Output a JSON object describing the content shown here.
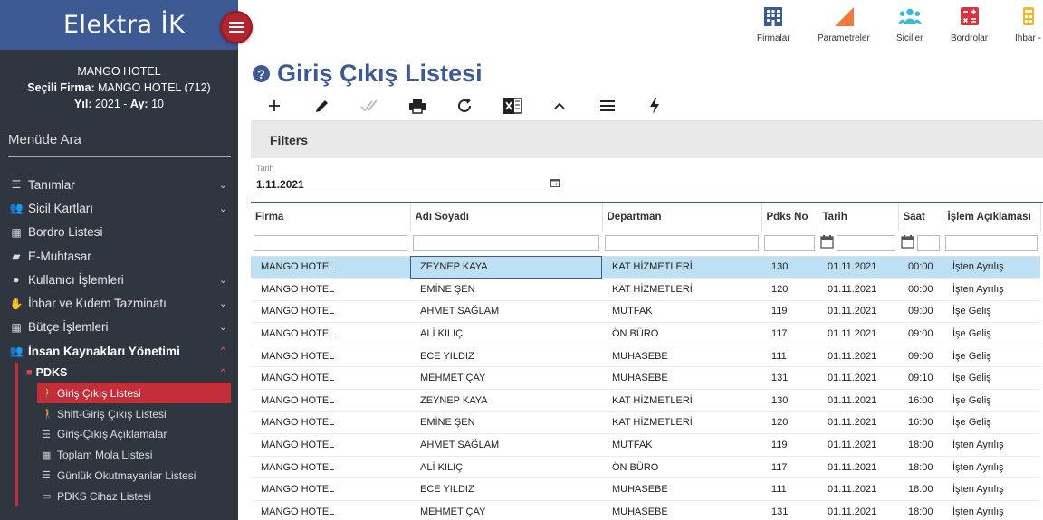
{
  "brand": {
    "title": "Elektra İK"
  },
  "firm_info": {
    "hotel": "MANGO HOTEL",
    "selected_label": "Seçili Firma:",
    "selected_value": "MANGO HOTEL (712)",
    "year_label": "Yıl:",
    "year_value": "2021",
    "month_label": "Ay:",
    "month_value": "10"
  },
  "menu_search": {
    "placeholder": "Menüde Ara"
  },
  "menu": {
    "items": [
      {
        "label": "Tanımlar",
        "icon": "list-icon"
      },
      {
        "label": "Sicil Kartları",
        "icon": "users-icon"
      },
      {
        "label": "Bordro Listesi",
        "icon": "calculator-icon"
      },
      {
        "label": "E-Muhtasar",
        "icon": "folder-icon"
      },
      {
        "label": "Kullanıcı İşlemleri",
        "icon": "user-gear-icon"
      },
      {
        "label": "İhbar ve Kıdem Tazminatı",
        "icon": "hand-money-icon"
      },
      {
        "label": "Bütçe İşlemleri",
        "icon": "calculator-icon"
      },
      {
        "label": "İnsan Kaynakları Yönetimi",
        "icon": "people-icon"
      }
    ],
    "pdks": {
      "label": "PDKS",
      "items": [
        {
          "label": "Giriş Çıkış Listesi",
          "icon": "walking-icon"
        },
        {
          "label": "Shift-Giriş Çıkış Listesi",
          "icon": "walking-icon"
        },
        {
          "label": "Giriş-Çıkış Açıklamalar",
          "icon": "list-icon"
        },
        {
          "label": "Toplam Mola Listesi",
          "icon": "table-icon"
        },
        {
          "label": "Günlük Okutmayanlar Listesi",
          "icon": "list-icon"
        },
        {
          "label": "PDKS Cihaz Listesi",
          "icon": "monitor-icon"
        }
      ]
    }
  },
  "topbar": {
    "buttons": [
      {
        "label": "Firmalar",
        "icon": "building-icon",
        "color": "#3d5a95"
      },
      {
        "label": "Parametreler",
        "icon": "triangle-icon",
        "color": "#f07a3c"
      },
      {
        "label": "Siciller",
        "icon": "users-icon",
        "color": "#3cb8d6"
      },
      {
        "label": "Bordrolar",
        "icon": "calculator-icon",
        "color": "#d6343f"
      },
      {
        "label": "İhbar -",
        "icon": "calculator-icon",
        "color": "#f2b632"
      }
    ]
  },
  "page": {
    "title": "Giriş Çıkış Listesi"
  },
  "filters": {
    "title": "Filters",
    "date_label": "Tarih",
    "date_value": "1.11.2021"
  },
  "table": {
    "columns": [
      "Firma",
      "Adı Soyadı",
      "Departman",
      "Pdks No",
      "Tarih",
      "Saat",
      "İşlem Açıklaması"
    ],
    "rows": [
      [
        "MANGO HOTEL",
        "ZEYNEP KAYA",
        "KAT HİZMETLERİ",
        "130",
        "01.11.2021",
        "00:00",
        "İşten Ayrılış"
      ],
      [
        "MANGO HOTEL",
        "EMİNE ŞEN",
        "KAT HİZMETLERİ",
        "120",
        "01.11.2021",
        "00:00",
        "İşten Ayrılış"
      ],
      [
        "MANGO HOTEL",
        "AHMET SAĞLAM",
        "MUTFAK",
        "119",
        "01.11.2021",
        "09:00",
        "İşe Geliş"
      ],
      [
        "MANGO HOTEL",
        "ALİ KILIÇ",
        "ÖN BÜRO",
        "117",
        "01.11.2021",
        "09:00",
        "İşe Geliş"
      ],
      [
        "MANGO HOTEL",
        "ECE YILDIZ",
        "MUHASEBE",
        "111",
        "01.11.2021",
        "09:00",
        "İşe Geliş"
      ],
      [
        "MANGO HOTEL",
        "MEHMET ÇAY",
        "MUHASEBE",
        "131",
        "01.11.2021",
        "09:10",
        "İşe Geliş"
      ],
      [
        "MANGO HOTEL",
        "ZEYNEP KAYA",
        "KAT HİZMETLERİ",
        "130",
        "01.11.2021",
        "16:00",
        "İşe Geliş"
      ],
      [
        "MANGO HOTEL",
        "EMİNE ŞEN",
        "KAT HİZMETLERİ",
        "120",
        "01.11.2021",
        "16:00",
        "İşe Geliş"
      ],
      [
        "MANGO HOTEL",
        "AHMET SAĞLAM",
        "MUTFAK",
        "119",
        "01.11.2021",
        "18:00",
        "İşten Ayrılış"
      ],
      [
        "MANGO HOTEL",
        "ALİ KILIÇ",
        "ÖN BÜRO",
        "117",
        "01.11.2021",
        "18:00",
        "İşten Ayrılış"
      ],
      [
        "MANGO HOTEL",
        "ECE YILDIZ",
        "MUHASEBE",
        "111",
        "01.11.2021",
        "18:00",
        "İşten Ayrılış"
      ],
      [
        "MANGO HOTEL",
        "MEHMET ÇAY",
        "MUHASEBE",
        "131",
        "01.11.2021",
        "18:00",
        "İşten Ayrılış"
      ]
    ]
  },
  "colors": {
    "brand": "#3d5a95",
    "accent": "#c52d39",
    "sidebar_bg": "#2f3640",
    "selected_row": "#bde0f5"
  }
}
